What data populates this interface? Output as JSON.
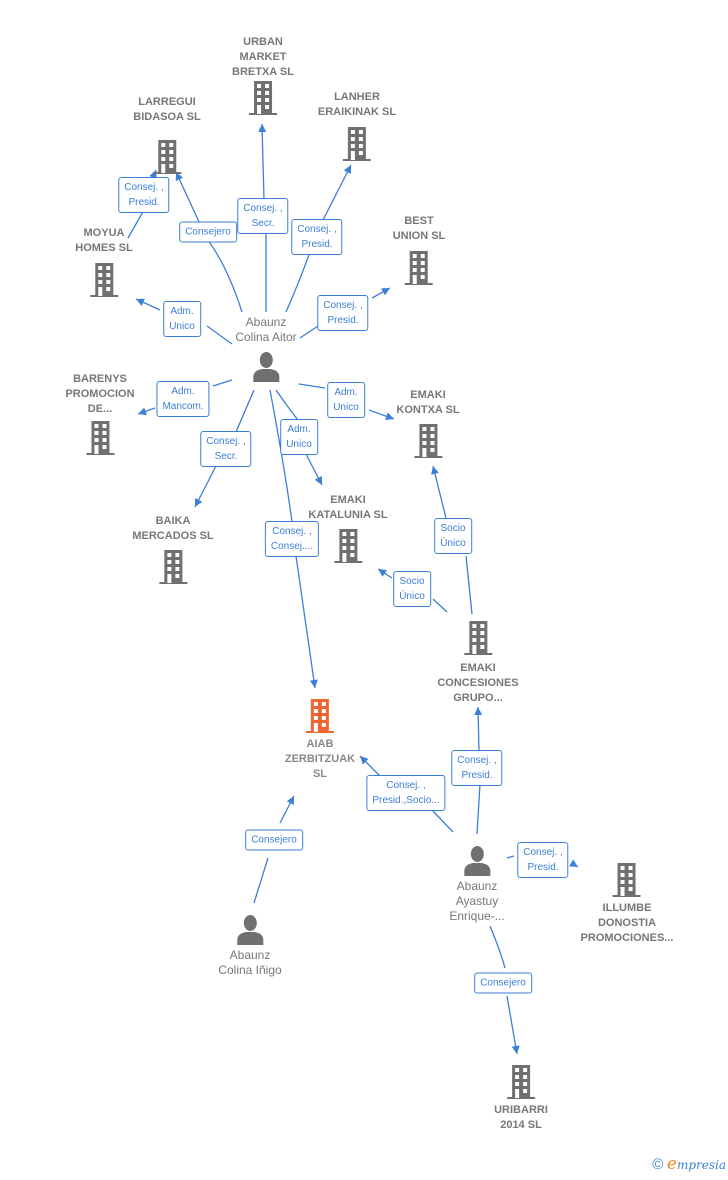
{
  "colors": {
    "edge": "#3c7fd7",
    "company_icon": "#707070",
    "main_company_icon": "#f26531",
    "person_icon": "#707070",
    "node_text": "#777777"
  },
  "nodes": [
    {
      "id": "urban",
      "type": "company",
      "label": "URBAN\nMARKET\nBRETXA  SL",
      "label_pos": "above"
    },
    {
      "id": "larregui",
      "type": "company",
      "label": "LARREGUI\nBIDASOA  SL",
      "label_pos": "above"
    },
    {
      "id": "lanher",
      "type": "company",
      "label": "LANHER\nERAIKINAK  SL",
      "label_pos": "above"
    },
    {
      "id": "moyua",
      "type": "company",
      "label": "MOYUA\nHOMES  SL",
      "label_pos": "above"
    },
    {
      "id": "best",
      "type": "company",
      "label": "BEST\nUNION  SL",
      "label_pos": "above"
    },
    {
      "id": "aitor",
      "type": "person",
      "label": "Abaunz\nColina Aitor",
      "label_pos": "above"
    },
    {
      "id": "barenys",
      "type": "company",
      "label": "BARENYS\nPROMOCION\nDE...",
      "label_pos": "above"
    },
    {
      "id": "kontxa",
      "type": "company",
      "label": "EMAKI\nKONTXA  SL",
      "label_pos": "above"
    },
    {
      "id": "baika",
      "type": "company",
      "label": "BAIKA\nMERCADOS  SL",
      "label_pos": "above"
    },
    {
      "id": "katalunia",
      "type": "company",
      "label": "EMAKI\nKATALUNIA  SL",
      "label_pos": "above"
    },
    {
      "id": "concesiones",
      "type": "company",
      "label": "EMAKI\nCONCESIONES\nGRUPO...",
      "label_pos": "below"
    },
    {
      "id": "aiab",
      "type": "main_company",
      "label": "AIAB\nZERBITZUAK\nSL",
      "label_pos": "below"
    },
    {
      "id": "enrique",
      "type": "person",
      "label": "Abaunz\nAyastuy\nEnrique-...",
      "label_pos": "below"
    },
    {
      "id": "illumbe",
      "type": "company",
      "label": "ILLUMBE\nDONOSTIA\nPROMOCIONES...",
      "label_pos": "below"
    },
    {
      "id": "inigo",
      "type": "person",
      "label": "Abaunz\nColina Iñigo",
      "label_pos": "below"
    },
    {
      "id": "uribarri",
      "type": "company",
      "label": "URIBARRI\n2014  SL",
      "label_pos": "below"
    }
  ],
  "edges": [
    {
      "from": "moyua",
      "to": "larregui",
      "label": "Consej. ,\nPresid."
    },
    {
      "from": "aitor",
      "to": "larregui",
      "label": "Consejero"
    },
    {
      "from": "aitor",
      "to": "urban",
      "label": "Consej. ,\nSecr."
    },
    {
      "from": "aitor",
      "to": "lanher",
      "label": "Consej. ,\nPresid."
    },
    {
      "from": "aitor",
      "to": "moyua",
      "label": "Adm.\nUnico"
    },
    {
      "from": "aitor",
      "to": "best",
      "label": "Consej. ,\nPresid."
    },
    {
      "from": "aitor",
      "to": "barenys",
      "label": "Adm.\nMancom."
    },
    {
      "from": "aitor",
      "to": "kontxa",
      "label": "Adm.\nUnico"
    },
    {
      "from": "aitor",
      "to": "baika",
      "label": "Consej. ,\nSecr."
    },
    {
      "from": "aitor",
      "to": "katalunia",
      "label": "Adm.\nUnico"
    },
    {
      "from": "aitor",
      "to": "aiab",
      "label": "Consej. ,\nConsej...."
    },
    {
      "from": "concesiones",
      "to": "kontxa",
      "label": "Socio\nÚnico"
    },
    {
      "from": "concesiones",
      "to": "katalunia",
      "label": "Socio\nÚnico"
    },
    {
      "from": "enrique",
      "to": "concesiones",
      "label": "Consej. ,\nPresid."
    },
    {
      "from": "enrique",
      "to": "aiab",
      "label": "Consej. ,\nPresid.,Socio..."
    },
    {
      "from": "enrique",
      "to": "illumbe",
      "label": "Consej. ,\nPresid."
    },
    {
      "from": "inigo",
      "to": "aiab",
      "label": "Consejero"
    },
    {
      "from": "enrique",
      "to": "uribarri",
      "label": "Consejero"
    }
  ],
  "footer": {
    "copyright": "©",
    "brand_initial": "e",
    "brand_rest": "mpresia"
  }
}
